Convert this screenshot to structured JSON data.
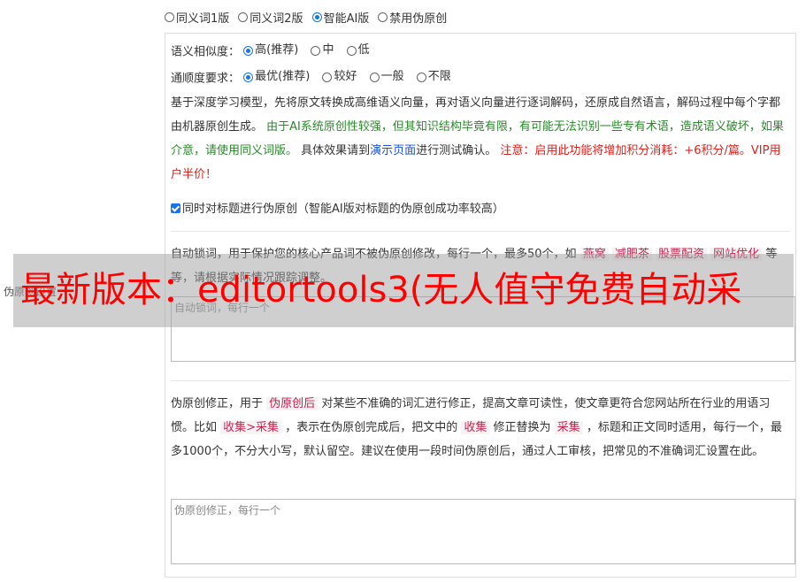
{
  "mode_options": [
    {
      "label": "同义词1版",
      "selected": false
    },
    {
      "label": "同义词2版",
      "selected": false
    },
    {
      "label": "智能AI版",
      "selected": true
    },
    {
      "label": "禁用伪原创",
      "selected": false
    }
  ],
  "similarity": {
    "label": "语义相似度：",
    "options": [
      {
        "label": "高(推荐)",
        "selected": true
      },
      {
        "label": "中",
        "selected": false
      },
      {
        "label": "低",
        "selected": false
      }
    ]
  },
  "fluency": {
    "label": "通顺度要求：",
    "options": [
      {
        "label": "最优(推荐)",
        "selected": true
      },
      {
        "label": "较好",
        "selected": false
      },
      {
        "label": "一般",
        "selected": false
      },
      {
        "label": "不限",
        "selected": false
      }
    ]
  },
  "description": {
    "part1": "基于深度学习模型，先将原文转换成高维语义向量，再对语义向量进行逐词解码，还原成自然语言，解码过程中每个字都由机器原创生成。",
    "green": "由于AI系统原创性较强，但其知识结构毕竟有限，有可能无法识别一些专有术语，造成语义破坏，如果介意，请使用同义词版。",
    "part2": "具体效果请到",
    "link": "演示页面",
    "part3": "进行测试确认。",
    "red": "注意：启用此功能将增加积分消耗：+6积分/篇。VIP用户半价！"
  },
  "title_checkbox": {
    "label": "同时对标题进行伪原创（智能AI版对标题的伪原创成功率较高）",
    "checked": true
  },
  "lock_words": {
    "text1": "自动锁词，用于保护您的核心产品词不被伪原创修改，每行一个，最多50个，如",
    "ex1": "燕窝",
    "ex2": "减肥茶",
    "ex3": "股票配资",
    "ex4": "网站优化",
    "text2": "等等，请根据实际情况跟踪调整。",
    "placeholder": "自动锁词，每行一个"
  },
  "side_label": "伪原创设置",
  "correction": {
    "t1": "伪原创修正，用于",
    "c1": "伪原创后",
    "t2": "对某些不准确的词汇进行修正，提高文章可读性，使文章更符合您网站所在行业的用语习惯。比如",
    "c2": "收集>采集",
    "t3": "，表示在伪原创完成后，把文中的",
    "c3": "收集",
    "t4": "修正替换为",
    "c4": "采集",
    "t5": "，标题和正文同时适用，每行一个，最多1000个，不分大小写，默认留空。建议在使用一段时间伪原创后，通过人工审核，把常见的不准确词汇设置在此。",
    "placeholder": "伪原创修正，每行一个"
  },
  "watermark": "最新版本：editortools3(无人值守免费自动采"
}
